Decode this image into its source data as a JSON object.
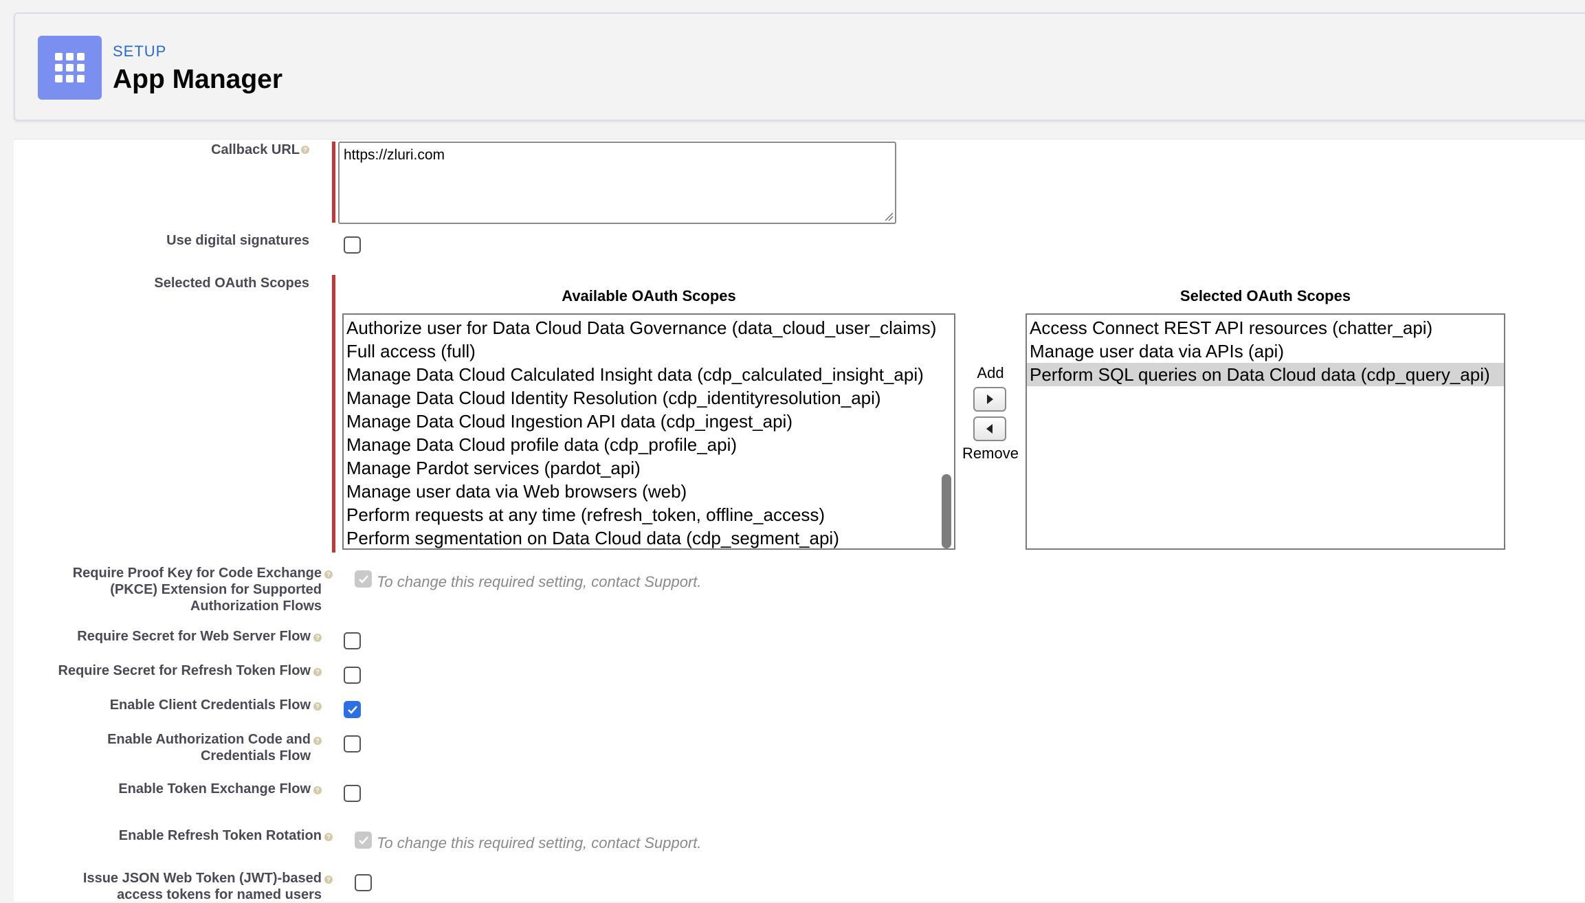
{
  "header": {
    "section_label": "SETUP",
    "title": "App Manager",
    "icon": "app-launcher-grid-icon",
    "icon_color": "#7a8ff0"
  },
  "form": {
    "callback_url": {
      "label": "Callback URL",
      "value": "https://zluri.com"
    },
    "digital_signatures": {
      "label": "Use digital signatures",
      "checked": false
    },
    "oauth_scopes": {
      "label": "Selected OAuth Scopes",
      "available_header": "Available OAuth Scopes",
      "selected_header": "Selected OAuth Scopes",
      "add_label": "Add",
      "remove_label": "Remove",
      "available": [
        "Authorize user for Data Cloud Data Governance (data_cloud_user_claims)",
        "Full access (full)",
        "Manage Data Cloud Calculated Insight data (cdp_calculated_insight_api)",
        "Manage Data Cloud Identity Resolution (cdp_identityresolution_api)",
        "Manage Data Cloud Ingestion API data (cdp_ingest_api)",
        "Manage Data Cloud profile data (cdp_profile_api)",
        "Manage Pardot services (pardot_api)",
        "Manage user data via Web browsers (web)",
        "Perform requests at any time (refresh_token, offline_access)",
        "Perform segmentation on Data Cloud data (cdp_segment_api)"
      ],
      "selected": [
        "Access Connect REST API resources (chatter_api)",
        "Manage user data via APIs (api)",
        "Perform SQL queries on Data Cloud data (cdp_query_api)"
      ]
    },
    "pkce": {
      "label_lines": [
        "Require Proof Key for Code Exchange",
        "(PKCE) Extension for Supported",
        "Authorization Flows"
      ],
      "note": "To change this required setting, contact Support.",
      "checked": true,
      "disabled": true
    },
    "secret_web_server": {
      "label": "Require Secret for Web Server Flow",
      "checked": false
    },
    "secret_refresh": {
      "label": "Require Secret for Refresh Token Flow",
      "checked": false
    },
    "client_credentials": {
      "label": "Enable Client Credentials Flow",
      "checked": true
    },
    "auth_code_credentials": {
      "label_lines": [
        "Enable Authorization Code and",
        "Credentials Flow"
      ],
      "checked": false
    },
    "token_exchange": {
      "label": "Enable Token Exchange Flow",
      "checked": false
    },
    "refresh_rotation": {
      "label": "Enable Refresh Token Rotation",
      "note": "To change this required setting, contact Support.",
      "checked": true,
      "disabled": true
    },
    "jwt": {
      "label_lines": [
        "Issue JSON Web Token (JWT)-based",
        "access tokens for named users"
      ],
      "checked": false
    }
  },
  "colors": {
    "required_bar": "#c23934",
    "checkbox_checked": "#2f6fe4",
    "link_blue": "#2a6bd1"
  }
}
